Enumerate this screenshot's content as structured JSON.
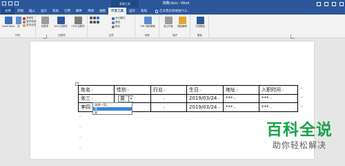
{
  "titlebar": {
    "doc_title": "简略.docx - Word",
    "context_group": "表格工具"
  },
  "ribbon_tabs": [
    {
      "label": "文件"
    },
    {
      "label": "开始"
    },
    {
      "label": "插入"
    },
    {
      "label": "设计"
    },
    {
      "label": "布局"
    },
    {
      "label": "引用"
    },
    {
      "label": "邮件"
    },
    {
      "label": "审阅"
    },
    {
      "label": "视图"
    },
    {
      "label": "开发工具"
    },
    {
      "label": "设计"
    },
    {
      "label": "布局"
    }
  ],
  "tell_me": "告诉我您想要做什么...",
  "ribbon": {
    "code": {
      "label": "代码",
      "visual_basic": "Visual Basic",
      "macros": "宏",
      "record_macro": "录制宏",
      "pause_recording": "暂停录制",
      "macro_security": "宏安全性"
    },
    "addins": {
      "label": "加载项",
      "addins": "加载项",
      "word_addins": "Word 加载项",
      "com_addins": "COM 加载项"
    },
    "controls": {
      "label": "控件",
      "design_mode": "设计模式",
      "properties": "属性",
      "group": "组合"
    },
    "mapping": {
      "label": "映射",
      "xml_pane": "XML 映射窗格"
    },
    "protect": {
      "label": "保护",
      "block_authors": "阻止作者",
      "restrict_editing": "限制编辑"
    },
    "templates": {
      "label": "模板",
      "document_template": "文档模板"
    }
  },
  "colors": {
    "accent": "#2b579a",
    "highlight": "#3d86d6",
    "watermark": "#1aa34a"
  },
  "table": {
    "headers": [
      "姓名",
      "性别",
      "行业",
      "生日",
      "地址",
      "入职时间"
    ],
    "rows": [
      [
        "张三",
        "男",
        "",
        "2019/03/24",
        "***",
        "***"
      ],
      [
        "李四",
        "",
        "",
        "2019/03/24",
        "***",
        "***"
      ]
    ]
  },
  "dropdown": {
    "current_value": "男",
    "options": [
      {
        "label": "选择一项。",
        "selected": false
      },
      {
        "label": "男",
        "selected": true
      },
      {
        "label": "女",
        "selected": false
      }
    ]
  },
  "watermark": {
    "main": "百科全说",
    "sub": "助你轻松解决"
  }
}
